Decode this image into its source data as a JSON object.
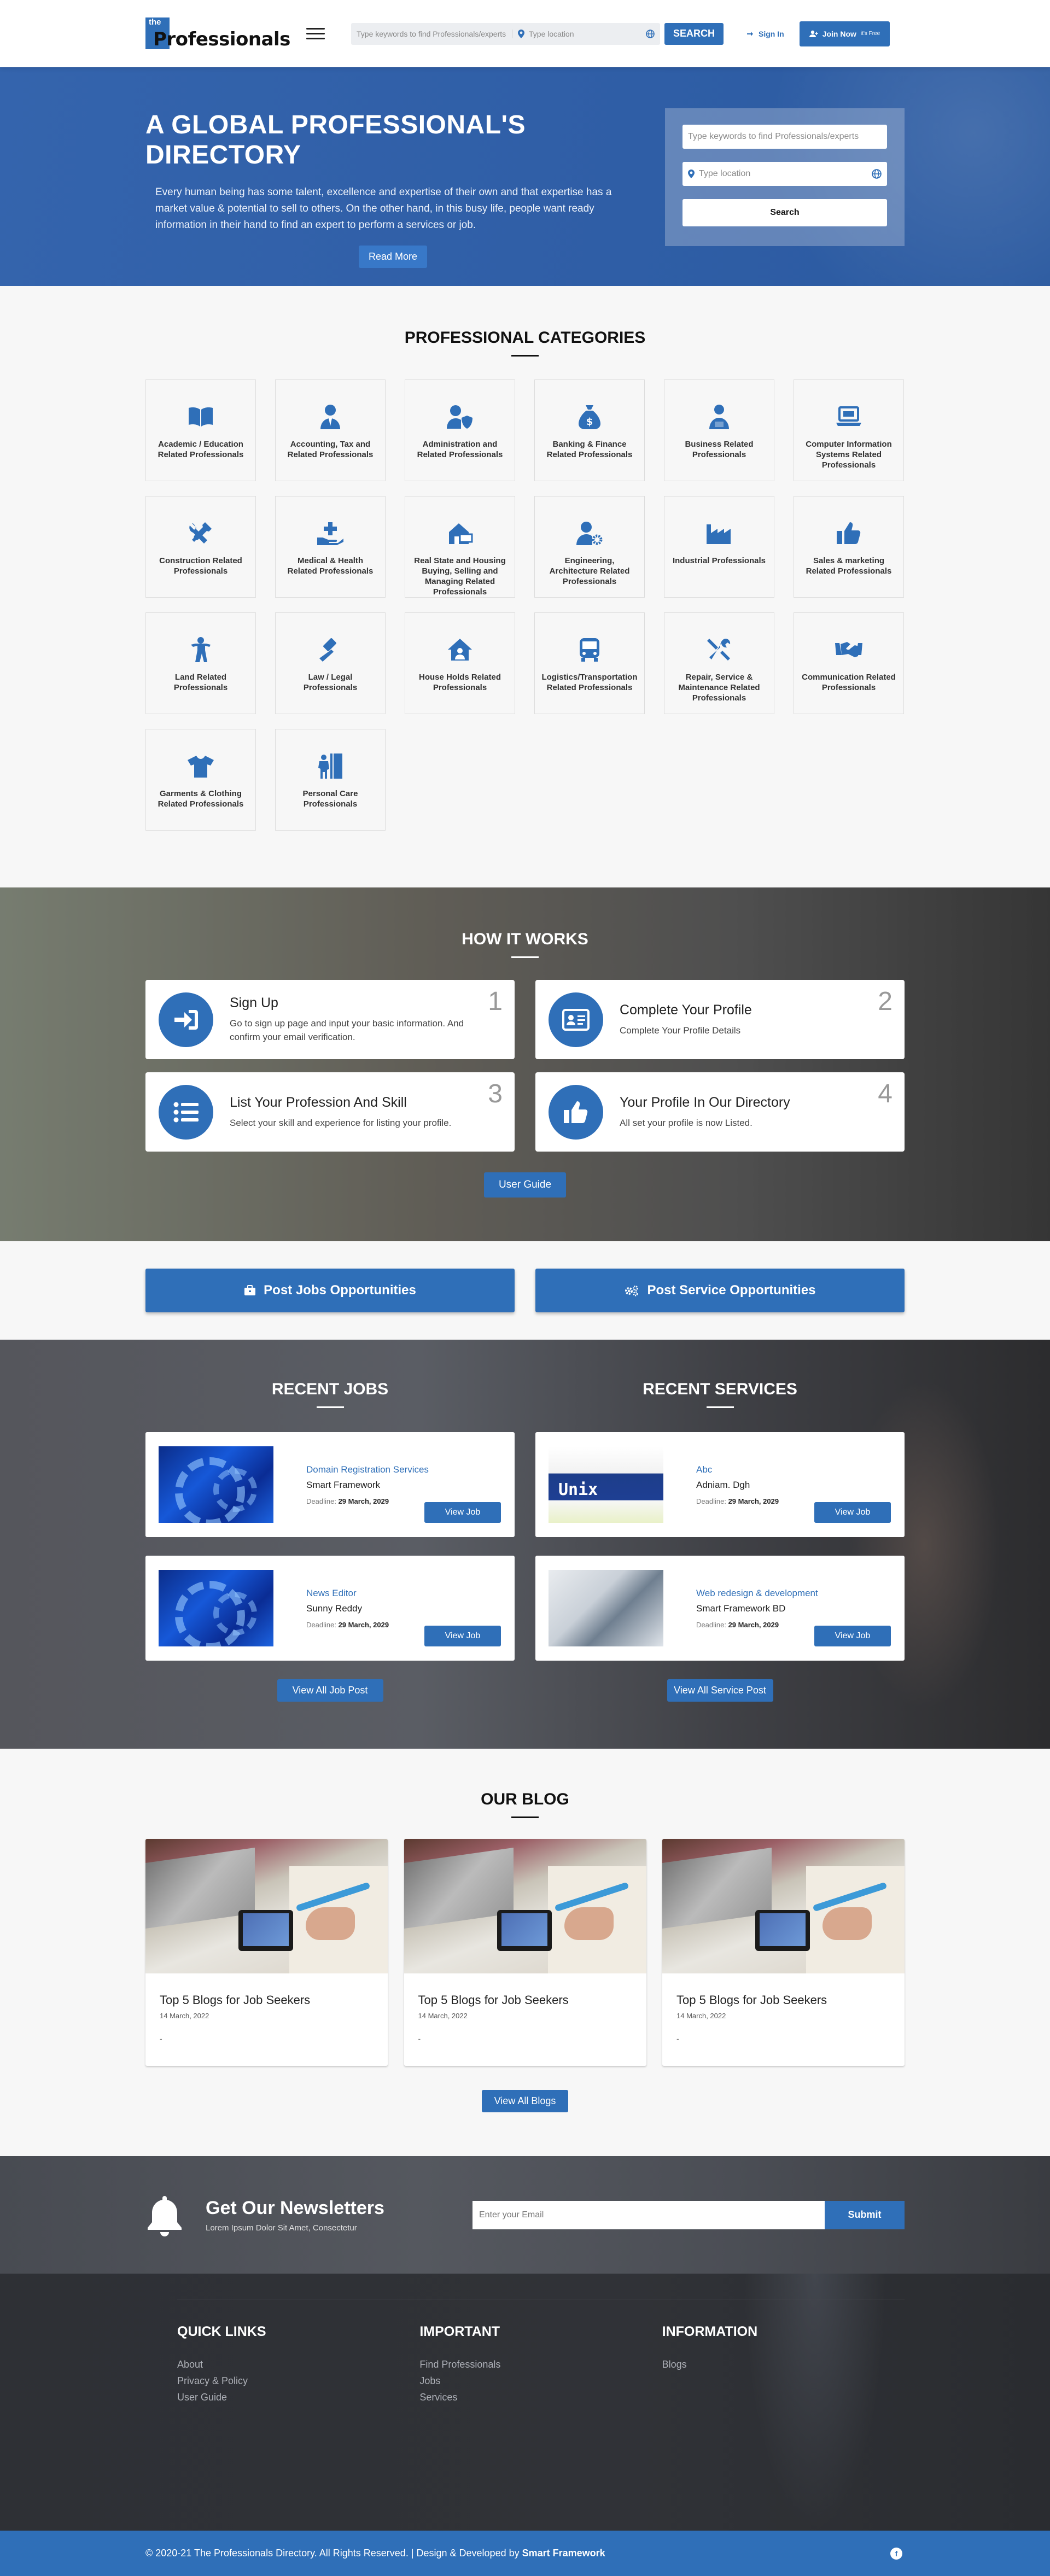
{
  "header": {
    "logo_the": "the",
    "logo_text": "Professionals",
    "search_placeholder": "Type keywords to find Professionals/experts",
    "location_placeholder": "Type location",
    "search_button": "SEARCH",
    "sign_in": "Sign In",
    "join_now": "Join Now",
    "join_now_small": "it's Free"
  },
  "hero": {
    "title": "A GLOBAL PROFESSIONAL'S DIRECTORY",
    "text": "Every human being has some talent, excellence and expertise of their own and that expertise has a market value & potential to sell to others. On the other hand, in this busy life, people want ready information in their hand to find an expert to perform a services or job.",
    "read_more": "Read More",
    "form_keyword_placeholder": "Type keywords to find Professionals/experts",
    "form_location_placeholder": "Type location",
    "form_button": "Search"
  },
  "categories": {
    "title": "PROFESSIONAL CATEGORIES",
    "items": [
      {
        "label": "Academic / Education Related Professionals",
        "icon": "book-icon"
      },
      {
        "label": "Accounting, Tax and Related Professionals",
        "icon": "user-tie-icon"
      },
      {
        "label": "Administration and Related Professionals",
        "icon": "user-shield-icon"
      },
      {
        "label": "Banking & Finance Related Professionals",
        "icon": "money-bag-icon"
      },
      {
        "label": "Business Related Professionals",
        "icon": "business-person-icon"
      },
      {
        "label": "Computer Information Systems Related Professionals",
        "icon": "laptop-icon"
      },
      {
        "label": "Construction Related Professionals",
        "icon": "tools-icon"
      },
      {
        "label": "Medical & Health Related Professionals",
        "icon": "hand-medical-icon"
      },
      {
        "label": "Real State and Housing Buying, Selling and Managing Related Professionals",
        "icon": "house-sale-icon"
      },
      {
        "label": "Engineering, Architecture Related Professionals",
        "icon": "user-cog-icon"
      },
      {
        "label": "Industrial Professionals",
        "icon": "industry-icon"
      },
      {
        "label": "Sales & marketing Related Professionals",
        "icon": "thumbs-up-icon"
      },
      {
        "label": "Land Related Professionals",
        "icon": "person-icon"
      },
      {
        "label": "Law / Legal Professionals",
        "icon": "gavel-icon"
      },
      {
        "label": "House Holds Related Professionals",
        "icon": "house-user-icon"
      },
      {
        "label": "Logistics/Transportation Related Professionals",
        "icon": "bus-icon"
      },
      {
        "label": "Repair, Service & Maintenance Related Professionals",
        "icon": "wrench-icon"
      },
      {
        "label": "Communication Related Professionals",
        "icon": "handshake-icon"
      },
      {
        "label": "Garments & Clothing Related Professionals",
        "icon": "tshirt-icon"
      },
      {
        "label": "Personal Care Professionals",
        "icon": "person-booth-icon"
      }
    ]
  },
  "how": {
    "title": "HOW IT WORKS",
    "steps": [
      {
        "title": "Sign Up",
        "desc": "Go to sign up page and input your basic information. And confirm your email verification.",
        "num": "1",
        "icon": "sign-in-icon"
      },
      {
        "title": "Complete Your Profile",
        "desc": "Complete Your Profile Details",
        "num": "2",
        "icon": "id-card-icon"
      },
      {
        "title": "List Your Profession And Skill",
        "desc": "Select your skill and experience for listing your profile.",
        "num": "3",
        "icon": "list-icon"
      },
      {
        "title": "Your Profile In Our Directory",
        "desc": "All set your profile is now Listed.",
        "num": "4",
        "icon": "thumbs-up-icon"
      }
    ],
    "guide_button": "User Guide"
  },
  "posts": {
    "jobs_button": "Post Jobs Opportunities",
    "services_button": "Post Service Opportunities"
  },
  "recent_jobs": {
    "title": "RECENT JOBS",
    "deadline_label": "Deadline:",
    "view_button": "View Job",
    "items": [
      {
        "title": "Domain Registration Services",
        "company": "Smart Framework",
        "deadline": "29 March, 2029"
      },
      {
        "title": "News Editor",
        "company": "Sunny Reddy",
        "deadline": "29 March, 2029"
      }
    ],
    "view_all": "View All Job Post"
  },
  "recent_services": {
    "title": "RECENT SERVICES",
    "deadline_label": "Deadline:",
    "view_button": "View Job",
    "items": [
      {
        "title": "Abc",
        "company": "Adniam. Dgh",
        "deadline": "29 March, 2029",
        "image_text": "Unix"
      },
      {
        "title": "Web redesign & development",
        "company": "Smart Framework BD",
        "deadline": "29 March, 2029"
      }
    ],
    "view_all": "View All Service Post"
  },
  "blog": {
    "title": "OUR BLOG",
    "posts": [
      {
        "title": "Top 5 Blogs for Job Seekers",
        "date": "14 March, 2022",
        "excerpt": "-"
      },
      {
        "title": "Top 5 Blogs for Job Seekers",
        "date": "14 March, 2022",
        "excerpt": "-"
      },
      {
        "title": "Top 5 Blogs for Job Seekers",
        "date": "14 March, 2022",
        "excerpt": "-"
      }
    ],
    "view_all": "View All Blogs"
  },
  "newsletter": {
    "title": "Get Our Newsletters",
    "subtitle": "Lorem Ipsum Dolor Sit Amet, Consectetur",
    "email_placeholder": "Enter your Email",
    "submit": "Submit"
  },
  "footer": {
    "columns": [
      {
        "heading": "QUICK LINKS",
        "links": [
          "About",
          "Privacy & Policy",
          "User Guide"
        ]
      },
      {
        "heading": "IMPORTANT",
        "links": [
          "Find Professionals",
          "Jobs",
          "Services"
        ]
      },
      {
        "heading": "INFORMATION",
        "links": [
          "Blogs"
        ]
      }
    ]
  },
  "copyright": {
    "text": "© 2020-21 The Professionals Directory. All Rights Reserved. | Design & Developed by ",
    "company": "Smart Framework",
    "facebook": "f"
  },
  "colors": {
    "brand": "#2f6fb8",
    "dark": "#2e3035"
  }
}
